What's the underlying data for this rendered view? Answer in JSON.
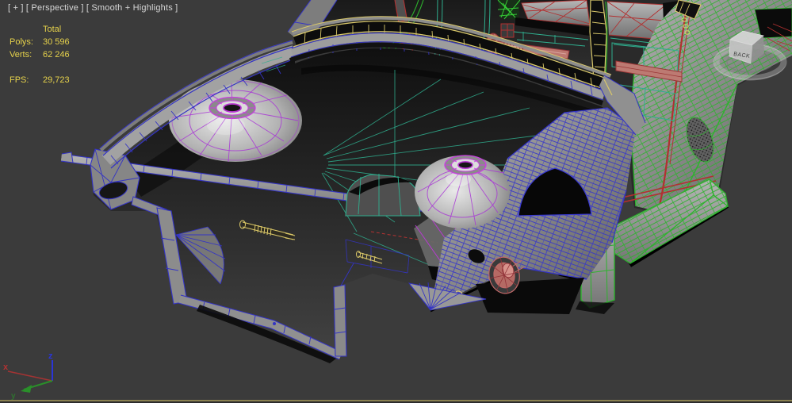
{
  "viewport": {
    "label": "[ + ] [ Perspective ] [ Smooth + Highlights ]",
    "background_color": "#3b3b3b",
    "active_border_color": "#8a8150"
  },
  "statistics": {
    "column_header": "Total",
    "rows": [
      {
        "label": "Polys:",
        "value": "30 596"
      },
      {
        "label": "Verts:",
        "value": "62 246"
      }
    ],
    "fps": {
      "label": "FPS:",
      "value": "29,723"
    },
    "text_color": "#e6d24b"
  },
  "axis_tripod": {
    "x": {
      "label": "x",
      "color": "#b03333"
    },
    "y": {
      "label": "y",
      "color": "#2a8f2a"
    },
    "z": {
      "label": "z",
      "color": "#2a35d8"
    }
  },
  "viewcube": {
    "front_label": "BACK"
  },
  "scene": {
    "wire_colors": {
      "front_body_blue": "#3434c4",
      "strut_tower_purple": "#a835d6",
      "ring_magenta": "#c93fe0",
      "windshield_frame_yellow": "#d9c86a",
      "rear_body_green": "#2db32d",
      "pillar_red": "#b23030",
      "interior_teal": "#2fae8e",
      "steering_parts_salmon": "#c27a73",
      "shaft_yellow": "#dcc968"
    }
  }
}
